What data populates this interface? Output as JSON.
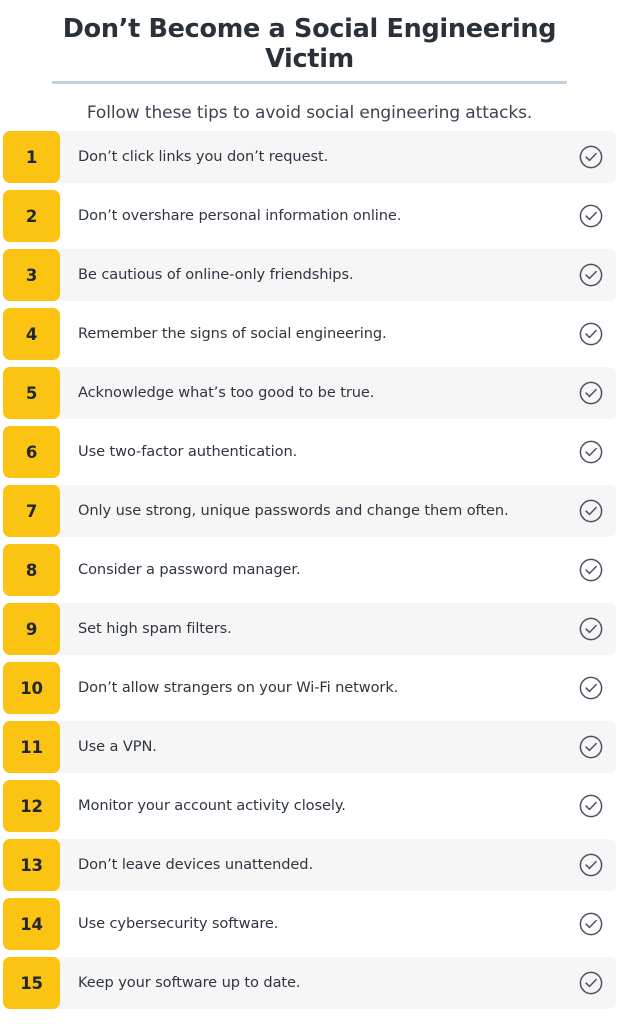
{
  "header": {
    "title": "Don’t Become a Social Engineering Victim",
    "subtitle": "Follow these tips to avoid social engineering attacks."
  },
  "colors": {
    "number_badge": "#FBC412",
    "title_text": "#2B3138",
    "body_text": "#2F3640",
    "title_rule": "#C3CEDF",
    "row_shaded": "#F6F6F7",
    "row_plain": "#FFFFFF",
    "check_icon": "#4A5261"
  },
  "list": {
    "check_icon_name": "check-circle-icon",
    "items": [
      {
        "number": "1",
        "text": "Don’t click links you don’t request."
      },
      {
        "number": "2",
        "text": "Don’t overshare personal information online."
      },
      {
        "number": "3",
        "text": "Be cautious of online-only friendships."
      },
      {
        "number": "4",
        "text": "Remember the signs of social engineering."
      },
      {
        "number": "5",
        "text": "Acknowledge what’s too good to be true."
      },
      {
        "number": "6",
        "text": "Use two-factor authentication."
      },
      {
        "number": "7",
        "text": "Only use strong, unique passwords and change them often."
      },
      {
        "number": "8",
        "text": "Consider a password manager."
      },
      {
        "number": "9",
        "text": "Set high spam filters."
      },
      {
        "number": "10",
        "text": "Don’t allow strangers on your Wi-Fi network."
      },
      {
        "number": "11",
        "text": "Use a VPN."
      },
      {
        "number": "12",
        "text": "Monitor your account activity closely."
      },
      {
        "number": "13",
        "text": "Don’t leave devices unattended."
      },
      {
        "number": "14",
        "text": "Use cybersecurity software."
      },
      {
        "number": "15",
        "text": "Keep your software up to date."
      }
    ]
  }
}
